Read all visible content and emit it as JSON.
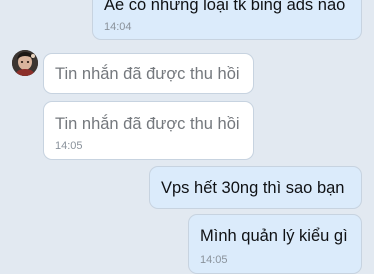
{
  "messages": [
    {
      "direction": "outgoing",
      "text": "Ae có những loại tk bing ads nào",
      "time": "14:04"
    },
    {
      "direction": "incoming",
      "text": "Tin nhắn đã được thu hồi",
      "recalled": true
    },
    {
      "direction": "incoming",
      "text": "Tin nhắn đã được thu hồi",
      "recalled": true,
      "time": "14:05"
    },
    {
      "direction": "outgoing",
      "text": "Vps hết 30ng thì sao bạn"
    },
    {
      "direction": "outgoing",
      "text": "Mình quản lý kiểu gì",
      "time": "14:05"
    }
  ],
  "colors": {
    "background": "#e2e9f1",
    "incoming_bubble": "#ffffff",
    "outgoing_bubble": "#dbebfb",
    "recalled_text": "#74787d",
    "timestamp": "#8a929b"
  }
}
